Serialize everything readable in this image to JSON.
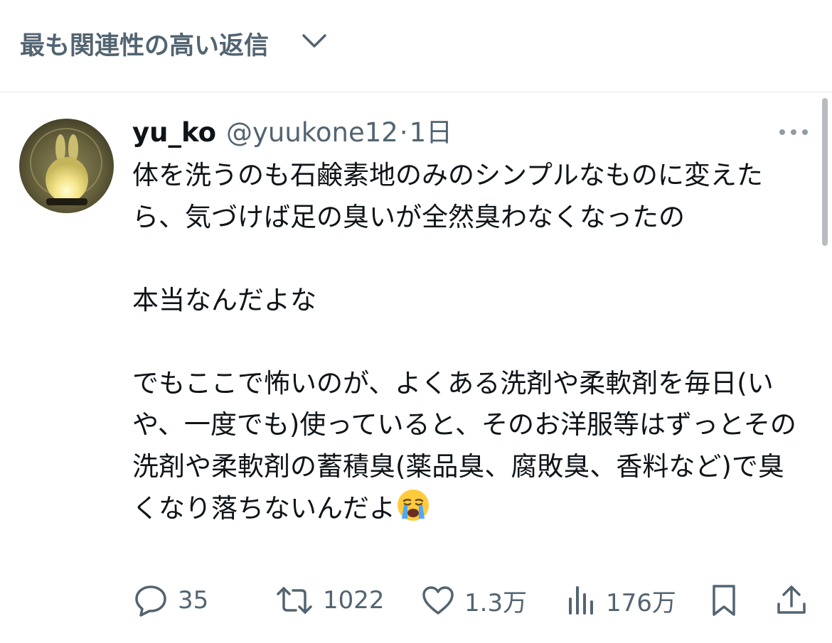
{
  "sort_header": {
    "label": "最も関連性の高い返信"
  },
  "tweet": {
    "display_name": "yu_ko",
    "handle": "@yuukone12",
    "separator": "·",
    "time": "1日",
    "text": "体を洗うのも石鹸素地のみのシンプルなものに変えたら、気づけば足の臭いが全然臭わなくなったの\n\n本当なんだよな\n\nでもここで怖いのが、よくある洗剤や柔軟剤を毎日(いや、一度でも)使っていると、そのお洋服等はずっとその洗剤や柔軟剤の蓄積臭(薬品臭、腐敗臭、香料など)で臭くなり落ちないんだよ",
    "emoji": "crying-face-emoji"
  },
  "actions": {
    "replies": "35",
    "retweets": "1022",
    "likes": "1.3万",
    "views": "176万"
  },
  "icons": {
    "sort": "chevron-down-icon",
    "more": "more-icon",
    "reply": "reply-icon",
    "retweet": "retweet-icon",
    "like": "heart-icon",
    "views": "views-icon",
    "bookmark": "bookmark-icon",
    "share": "share-icon"
  },
  "colors": {
    "text": "#0f1419",
    "secondary": "#536471",
    "divider": "#e1e5e8"
  }
}
